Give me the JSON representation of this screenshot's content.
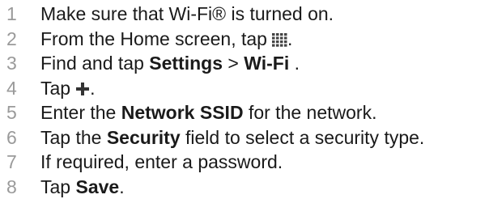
{
  "steps": [
    {
      "number": "1",
      "text": "Make sure that Wi-Fi® is turned on."
    },
    {
      "number": "2",
      "text": "From the Home screen, tap",
      "after_icon": ".",
      "icon": "apps-grid-icon"
    },
    {
      "number": "3",
      "pre": "Find and tap ",
      "bold1": "Settings",
      "mid": " > ",
      "bold2": "Wi-Fi",
      "post": " ."
    },
    {
      "number": "4",
      "text": "Tap",
      "after_icon": ".",
      "icon": "plus-icon"
    },
    {
      "number": "5",
      "pre": "Enter the ",
      "bold": "Network SSID",
      "post": " for the network."
    },
    {
      "number": "6",
      "pre": "Tap the ",
      "bold": "Security",
      "post": " field to select a security type."
    },
    {
      "number": "7",
      "text": "If required, enter a password."
    },
    {
      "number": "8",
      "pre": "Tap ",
      "bold": "Save",
      "post": "."
    }
  ],
  "colors": {
    "step_number": "#9a9a9a",
    "text": "#1a1a1a",
    "plus_icon": "#333333"
  }
}
